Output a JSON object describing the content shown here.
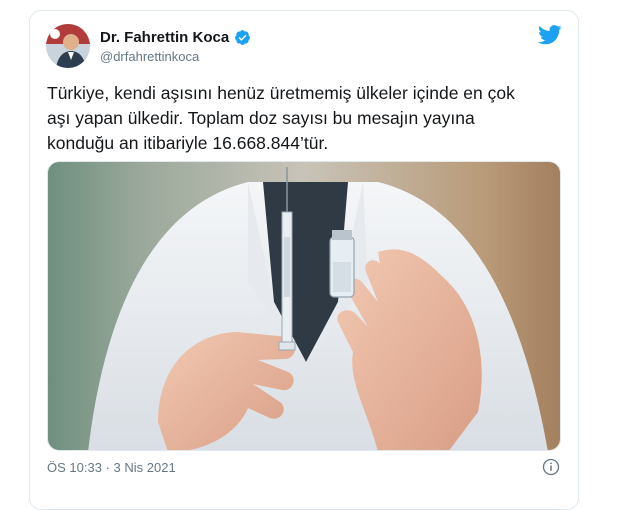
{
  "tweet": {
    "author_name": "Dr. Fahrettin Koca",
    "handle": "@drfahrettinkoca",
    "text": "Türkiye, kendi aşısını henüz üretmemiş ülkeler içinde en çok\naşı yapan ülkedir. Toplam doz sayısı bu mesajın yayına\nkonduğu an itibariyle 16.668.844’tür.",
    "time": "ÖS 10:33",
    "separator": "·",
    "date": "3 Nis 2021"
  },
  "colors": {
    "twitter_blue": "#1da1f2",
    "verified": "#1da1f2",
    "secondary_text": "#657786",
    "border": "#e1e8ed"
  },
  "icons": {
    "bird": "twitter-bird-icon",
    "verified": "verified-badge-icon",
    "info": "info-icon"
  }
}
